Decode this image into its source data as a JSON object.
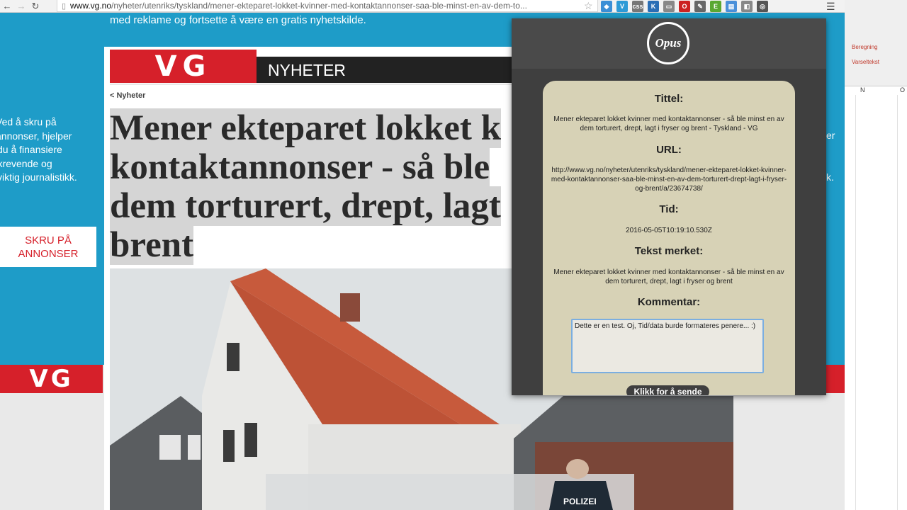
{
  "browser": {
    "back_icon": "back-arrow-icon",
    "forward_icon": "forward-arrow-icon",
    "reload_icon": "reload-icon",
    "url_host": "www.vg.no",
    "url_path": "/nyheter/utenriks/tyskland/mener-ekteparet-lokket-kvinner-med-kontaktannonser-saa-ble-minst-en-av-dem-to...",
    "star_icon": "bookmark-star-icon",
    "extension_icons": [
      {
        "name": "dropbox-icon",
        "glyph": "◆",
        "color": "#3b8fd6"
      },
      {
        "name": "vimeo-icon",
        "glyph": "V",
        "color": "#2d9ad6"
      },
      {
        "name": "css-icon",
        "glyph": "css",
        "color": "#777777"
      },
      {
        "name": "k-icon",
        "glyph": "K",
        "color": "#2a6eb5"
      },
      {
        "name": "cast-icon",
        "glyph": "▭",
        "color": "#888888"
      },
      {
        "name": "opera-icon",
        "glyph": "O",
        "color": "#cc2222"
      },
      {
        "name": "eyedropper-icon",
        "glyph": "✎",
        "color": "#666666"
      },
      {
        "name": "evernote-icon",
        "glyph": "E",
        "color": "#5aa832"
      },
      {
        "name": "doc-icon",
        "glyph": "▤",
        "color": "#4a90d9"
      },
      {
        "name": "tag-icon",
        "glyph": "◧",
        "color": "#888888"
      },
      {
        "name": "opus-extension-icon",
        "glyph": "◎",
        "color": "#555555"
      }
    ],
    "menu_icon": "hamburger-menu-icon"
  },
  "banner": {
    "top_text": "med reklame og fortsette å være en gratis nyhetskilde.",
    "left_lines": [
      "Ved å skru på",
      "annonser, hjelper",
      "du å finansiere",
      "kvalitetskrevende og",
      "viktig journalistikk."
    ],
    "button_lines": [
      "SKRU PÅ",
      "ANNONSER"
    ],
    "logo_text": "VG",
    "right_text1": "er",
    "right_text2": "k."
  },
  "article": {
    "logo": "VG",
    "section": "NYHETER",
    "breadcrumb": "< Nyheter",
    "headline_lines": [
      "Mener ekteparet lokket k",
      "kontaktannonser - så ble",
      "dem torturert, drept, lagt",
      "brent"
    ],
    "photo_caption_badge": "POLIZEI"
  },
  "spreadsheet": {
    "label1": "Beregning",
    "label2": "Varseltekst",
    "col_n": "N",
    "col_o": "O"
  },
  "popup": {
    "logo_text": "Opus",
    "title_label": "Tittel:",
    "title_value": "Mener ekteparet lokket kvinner med kontaktannonser - så ble minst en av dem torturert, drept, lagt i fryser og brent - Tyskland - VG",
    "url_label": "URL:",
    "url_value": "http://www.vg.no/nyheter/utenriks/tyskland/mener-ekteparet-lokket-kvinner-med-kontaktannonser-saa-ble-minst-en-av-dem-torturert-drept-lagt-i-fryser-og-brent/a/23674738/",
    "time_label": "Tid:",
    "time_value": "2016-05-05T10:19:10.530Z",
    "selected_label": "Tekst merket:",
    "selected_value": "Mener ekteparet lokket kvinner med kontaktannonser - så ble minst en av dem torturert, drept, lagt i fryser og brent",
    "comment_label": "Kommentar:",
    "comment_value": "Dette er en test. Oj, Tid/data burde formateres penere... :)",
    "send_label": "Klikk for å sende"
  }
}
